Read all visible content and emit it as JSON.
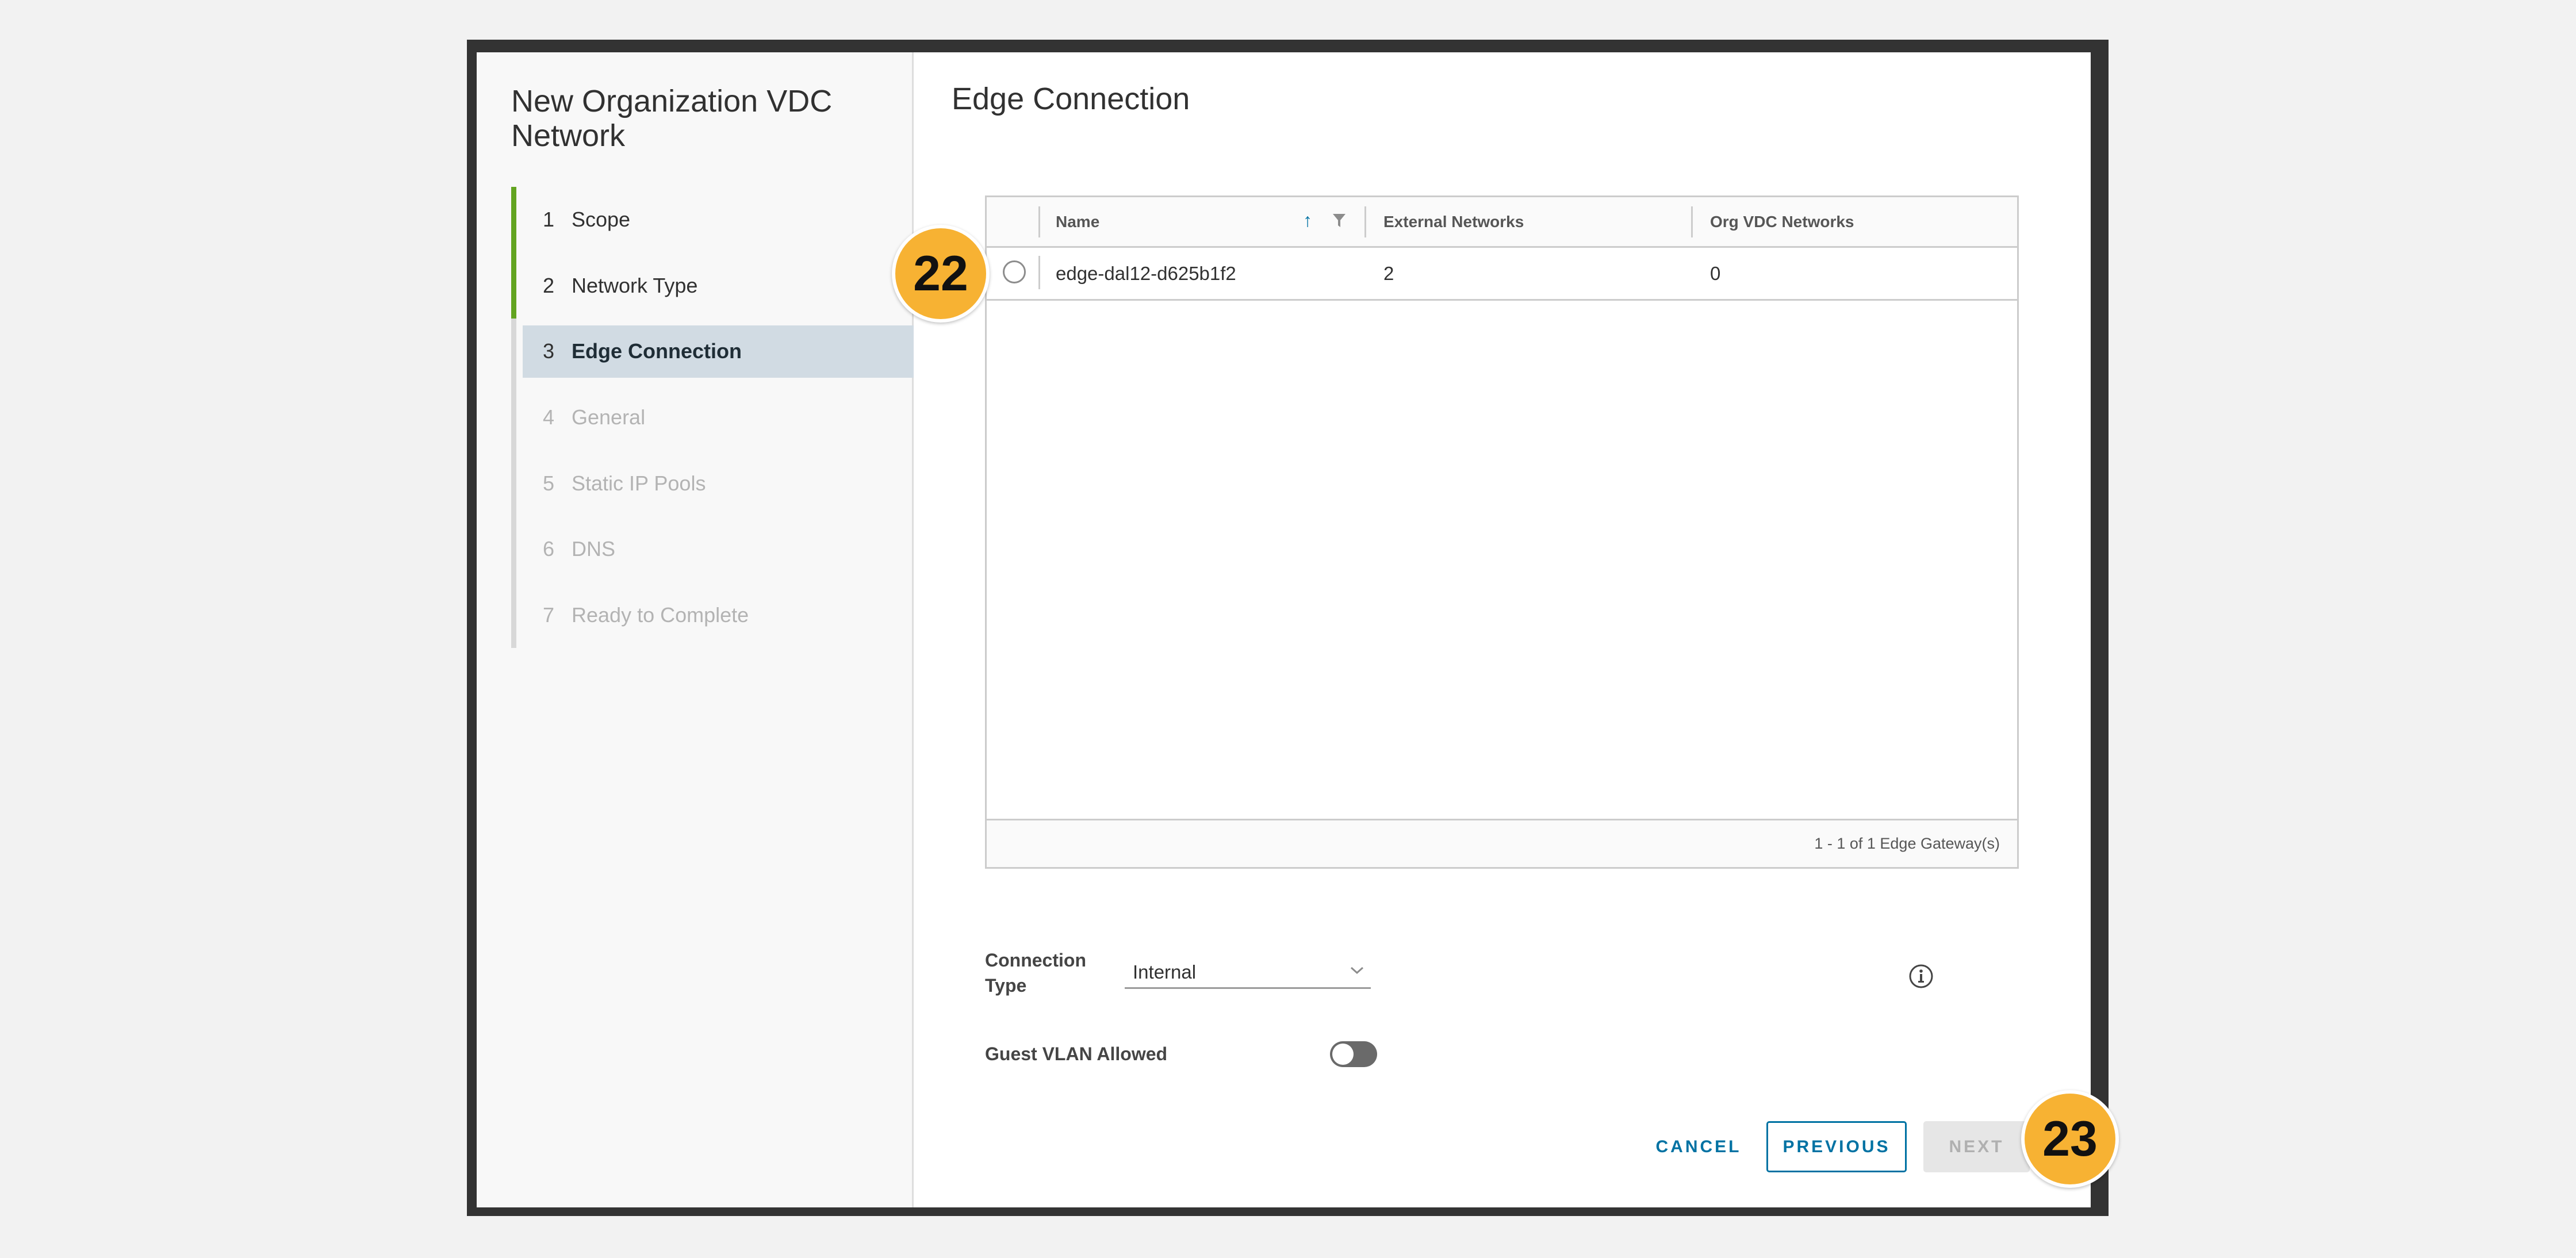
{
  "wizard": {
    "title": "New Organization VDC Network",
    "steps": [
      {
        "num": "1",
        "label": "Scope",
        "state": "done"
      },
      {
        "num": "2",
        "label": "Network Type",
        "state": "done"
      },
      {
        "num": "3",
        "label": "Edge Connection",
        "state": "active"
      },
      {
        "num": "4",
        "label": "General",
        "state": "todo"
      },
      {
        "num": "5",
        "label": "Static IP Pools",
        "state": "todo"
      },
      {
        "num": "6",
        "label": "DNS",
        "state": "todo"
      },
      {
        "num": "7",
        "label": "Ready to Complete",
        "state": "todo"
      }
    ]
  },
  "main": {
    "title": "Edge Connection",
    "grid": {
      "columns": [
        "Name",
        "External Networks",
        "Org VDC Networks"
      ],
      "rows": [
        {
          "name": "edge-dal12-d625b1f2",
          "external_networks": "2",
          "org_vdc_networks": "0"
        }
      ],
      "footer": "1 - 1 of 1 Edge Gateway(s)"
    },
    "connection_type": {
      "label_line1": "Connection",
      "label_line2": "Type",
      "value": "Internal"
    },
    "guest_vlan": {
      "label": "Guest VLAN Allowed",
      "enabled": false
    }
  },
  "buttons": {
    "cancel": "CANCEL",
    "previous": "PREVIOUS",
    "next": "NEXT"
  },
  "callouts": {
    "first": "22",
    "second": "23"
  },
  "colors": {
    "accent": "#0072a3",
    "done_bar": "#62a420",
    "badge": "#f7b233"
  },
  "icons": {
    "sort": "sort-ascending-icon",
    "filter": "filter-icon",
    "info": "info-icon",
    "chevron": "chevron-down-icon"
  }
}
